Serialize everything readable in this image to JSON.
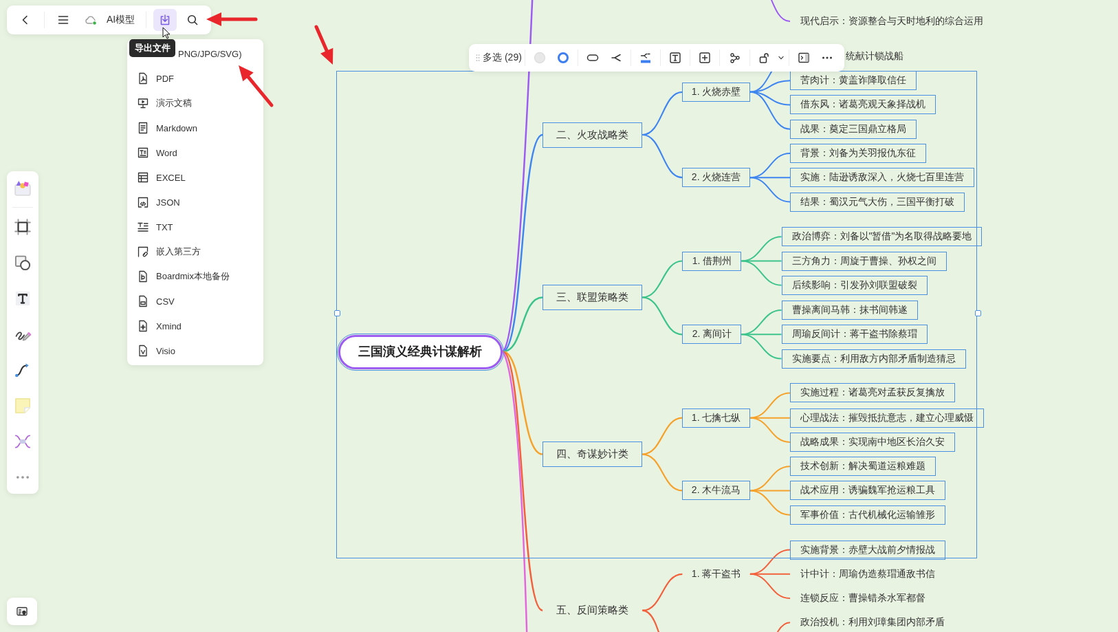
{
  "toolbar": {
    "ai_model_label": "AI模型",
    "export_selected": true,
    "tooltip": "导出文件"
  },
  "export_menu": {
    "items": [
      {
        "label": "PNG/JPG/SVG)",
        "kind": "image"
      },
      {
        "label": "PDF",
        "kind": "pdf"
      },
      {
        "label": "演示文稿",
        "kind": "slides"
      },
      {
        "label": "Markdown",
        "kind": "markdown"
      },
      {
        "label": "Word",
        "kind": "word"
      },
      {
        "label": "EXCEL",
        "kind": "excel"
      },
      {
        "label": "JSON",
        "kind": "json"
      },
      {
        "label": "TXT",
        "kind": "txt"
      },
      {
        "label": "嵌入第三方",
        "kind": "embed"
      },
      {
        "label": "Boardmix本地备份",
        "kind": "backup"
      },
      {
        "label": "CSV",
        "kind": "csv"
      },
      {
        "label": "Xmind",
        "kind": "xmind"
      },
      {
        "label": "Visio",
        "kind": "visio"
      }
    ]
  },
  "selection_toolbar": {
    "label": "多选 (29)"
  },
  "mindmap": {
    "root": {
      "text": "三国演义经典计谋解析",
      "selected": true
    },
    "branches": [
      {
        "color": "#9c5cf2",
        "children": [
          {
            "children": [
              {
                "text": "现代启示：资源整合与天时地利的综合运用",
                "selected": false
              }
            ]
          }
        ]
      },
      {
        "text": "二、火攻战略类",
        "selected": true,
        "color": "#3f86f0",
        "children": [
          {
            "text": "1. 火烧赤壁",
            "selected": true,
            "children": [
              {
                "text": "统献计锁战船",
                "selected": false
              },
              {
                "text": "苦肉计：黄盖诈降取信任",
                "selected": true
              },
              {
                "text": "借东风：诸葛亮观天象择战机",
                "selected": true
              },
              {
                "text": "战果：奠定三国鼎立格局",
                "selected": true
              }
            ]
          },
          {
            "text": "2. 火烧连营",
            "selected": true,
            "children": [
              {
                "text": "背景：刘备为关羽报仇东征",
                "selected": true
              },
              {
                "text": "实施：陆逊诱敌深入，火烧七百里连营",
                "selected": true
              },
              {
                "text": "结果：蜀汉元气大伤，三国平衡打破",
                "selected": true
              }
            ]
          }
        ]
      },
      {
        "text": "三、联盟策略类",
        "selected": true,
        "color": "#3cc48c",
        "children": [
          {
            "text": "1. 借荆州",
            "selected": true,
            "children": [
              {
                "text": "政治博弈：刘备以\"暂借\"为名取得战略要地",
                "selected": true
              },
              {
                "text": "三方角力：周旋于曹操、孙权之间",
                "selected": true
              },
              {
                "text": "后续影响：引发孙刘联盟破裂",
                "selected": true
              }
            ]
          },
          {
            "text": "2. 离间计",
            "selected": true,
            "children": [
              {
                "text": "曹操离间马韩：抹书间韩遂",
                "selected": true
              },
              {
                "text": "周瑜反间计：蒋干盗书除蔡瑁",
                "selected": true
              },
              {
                "text": "实施要点：利用敌方内部矛盾制造猜忌",
                "selected": true
              }
            ]
          }
        ]
      },
      {
        "text": "四、奇谋妙计类",
        "selected": true,
        "color": "#f5a12a",
        "children": [
          {
            "text": "1. 七擒七纵",
            "selected": true,
            "children": [
              {
                "text": "实施过程：诸葛亮对孟获反复擒放",
                "selected": true
              },
              {
                "text": "心理战法：摧毁抵抗意志，建立心理威慑",
                "selected": true
              },
              {
                "text": "战略成果：实现南中地区长治久安",
                "selected": true
              }
            ]
          },
          {
            "text": "2. 木牛流马",
            "selected": true,
            "children": [
              {
                "text": "技术创新：解决蜀道运粮难题",
                "selected": true
              },
              {
                "text": "战术应用：诱骗魏军抢运粮工具",
                "selected": true
              },
              {
                "text": "军事价值：古代机械化运输雏形",
                "selected": true
              }
            ]
          }
        ]
      },
      {
        "text": "五、反间策略类",
        "selected": false,
        "color": "#f2603c",
        "children": [
          {
            "text": "1. 蒋干盗书",
            "selected": false,
            "children": [
              {
                "text": "实施背景：赤壁大战前夕情报战",
                "selected": true
              },
              {
                "text": "计中计：周瑜伪造蔡瑁通敌书信",
                "selected": false
              },
              {
                "text": "连锁反应：曹操错杀水军都督",
                "selected": false
              }
            ]
          },
          {
            "children": [
              {
                "text": "政治投机：利用刘璋集团内部矛盾",
                "selected": false
              }
            ]
          }
        ]
      },
      {
        "color": "#e466dc"
      }
    ]
  }
}
